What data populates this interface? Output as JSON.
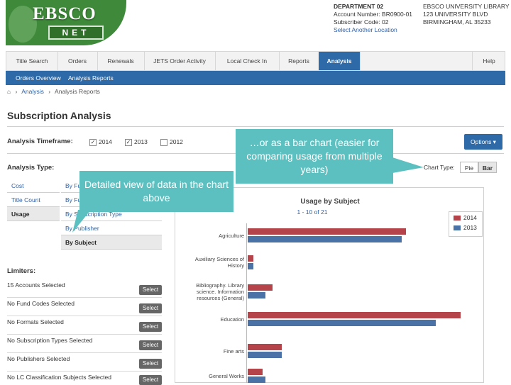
{
  "logo": {
    "text_top": "EBSCO",
    "text_bottom": "NET"
  },
  "account": {
    "department": "DEPARTMENT 02",
    "account_number": "Account Number: BR0900-01",
    "subscriber_code": "Subscriber Code: 02",
    "select_location": "Select Another Location",
    "library_name": "EBSCO UNIVERSITY LIBRARY",
    "address1": "123 UNIVERSITY BLVD",
    "address2": "BIRMINGHAM, AL 35233"
  },
  "nav": {
    "tabs": [
      "Title Search",
      "Orders",
      "Renewals",
      "JETS Order Activity",
      "Local Check In",
      "Reports",
      "Analysis",
      "Help"
    ],
    "active": "Analysis"
  },
  "subnav": {
    "items": [
      "Orders Overview",
      "Analysis Reports"
    ]
  },
  "breadcrumb": {
    "home_icon": "home-icon",
    "items": [
      "Analysis",
      "Analysis Reports"
    ]
  },
  "page_title": "Subscription Analysis",
  "timeframe": {
    "label": "Analysis Timeframe:",
    "years": [
      {
        "year": "2014",
        "checked": true
      },
      {
        "year": "2013",
        "checked": true
      },
      {
        "year": "2012",
        "checked": false
      }
    ]
  },
  "options_label": "Options ▾",
  "analysis_type": {
    "label": "Analysis Type:",
    "left": [
      "Cost",
      "Title Count",
      "Usage"
    ],
    "left_selected": "Usage",
    "right": [
      "By Fund",
      "By Fund Code",
      "By Subscription Type",
      "By Publisher",
      "By Subject"
    ],
    "right_selected": "By Subject"
  },
  "limiters": {
    "label": "Limiters:",
    "items": [
      {
        "text": "15 Accounts Selected",
        "button": "Select"
      },
      {
        "text": "No Fund Codes Selected",
        "button": "Select"
      },
      {
        "text": "No Formats Selected",
        "button": "Select"
      },
      {
        "text": "No Subscription Types Selected",
        "button": "Select"
      },
      {
        "text": "No Publishers Selected",
        "button": "Select"
      },
      {
        "text": "No LC Classification Subjects Selected",
        "button": "Select"
      }
    ]
  },
  "chart_type": {
    "label": "Chart Type:",
    "options": [
      "Pie",
      "Bar"
    ],
    "selected": "Bar"
  },
  "callouts": {
    "detail": "Detailed view of data in the chart above",
    "bar": "…or as a bar chart (easier for comparing usage from multiple years)"
  },
  "colors": {
    "series_2014": "#b4444a",
    "series_2013": "#4a72a6",
    "nav_blue": "#2e6aa8",
    "callout": "#5dc0c0"
  },
  "chart_data": {
    "type": "bar",
    "title": "Usage by Subject",
    "subtitle": "1 - 10 of 21",
    "orientation": "horizontal",
    "categories": [
      "Agriculture",
      "Auxiliary Sciences of History",
      "Bibliography. Library science. Information resources (General)",
      "Education",
      "Fine arts",
      "General Works"
    ],
    "category_display": [
      [
        "Agriculture"
      ],
      [
        "Auxiliary Sciences of",
        "History"
      ],
      [
        "Bibliography. Library",
        "science. Information",
        "resources (General)"
      ],
      [
        "Education"
      ],
      [
        "Fine arts"
      ],
      [
        "General Works"
      ]
    ],
    "series": [
      {
        "name": "2014",
        "values": [
          230,
          8,
          36,
          310,
          50,
          22
        ]
      },
      {
        "name": "2013",
        "values": [
          224,
          8,
          26,
          274,
          50,
          26
        ]
      }
    ],
    "xlim": [
      0,
      320
    ],
    "legend": "top-right",
    "grid": false
  }
}
